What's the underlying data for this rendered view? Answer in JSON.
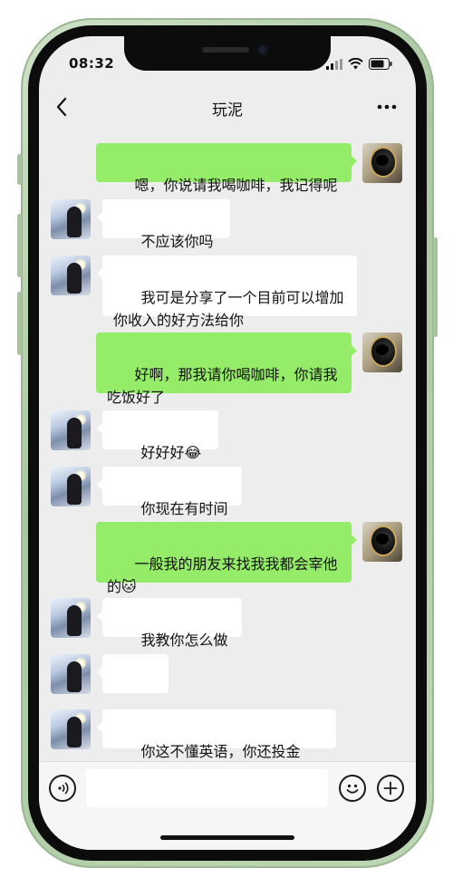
{
  "status_bar": {
    "time": "08:32"
  },
  "nav": {
    "title": "玩泥"
  },
  "messages": [
    {
      "side": "out",
      "text": "嗯，你说请我喝咖啡，我记得呢"
    },
    {
      "side": "in",
      "text": "不应该你吗😂"
    },
    {
      "side": "in",
      "text": "我可是分享了一个目前可以增加\n你收入的好方法给你"
    },
    {
      "side": "out",
      "text": "好啊，那我请你喝咖啡，你请我\n吃饭好了"
    },
    {
      "side": "in",
      "text": "好好好😂😂"
    },
    {
      "side": "in",
      "text": "你现在有时间吧"
    },
    {
      "side": "out",
      "text": "一般我的朋友来找我我都会宰他\n的🐱"
    },
    {
      "side": "in",
      "text": "我教你怎么做吧"
    },
    {
      "side": "in",
      "text": "😂😂"
    },
    {
      "side": "in",
      "text": "你这不懂英语，你还投金融。"
    }
  ],
  "input": {
    "value": "",
    "placeholder": ""
  },
  "colors": {
    "bubble_out": "#95ec69",
    "bubble_in": "#ffffff",
    "chat_bg": "#ededed"
  },
  "icons": {
    "back": "chevron-left-icon",
    "more": "more-dots-icon",
    "voice": "voice-icon",
    "emoji": "emoji-icon",
    "plus": "plus-icon"
  }
}
